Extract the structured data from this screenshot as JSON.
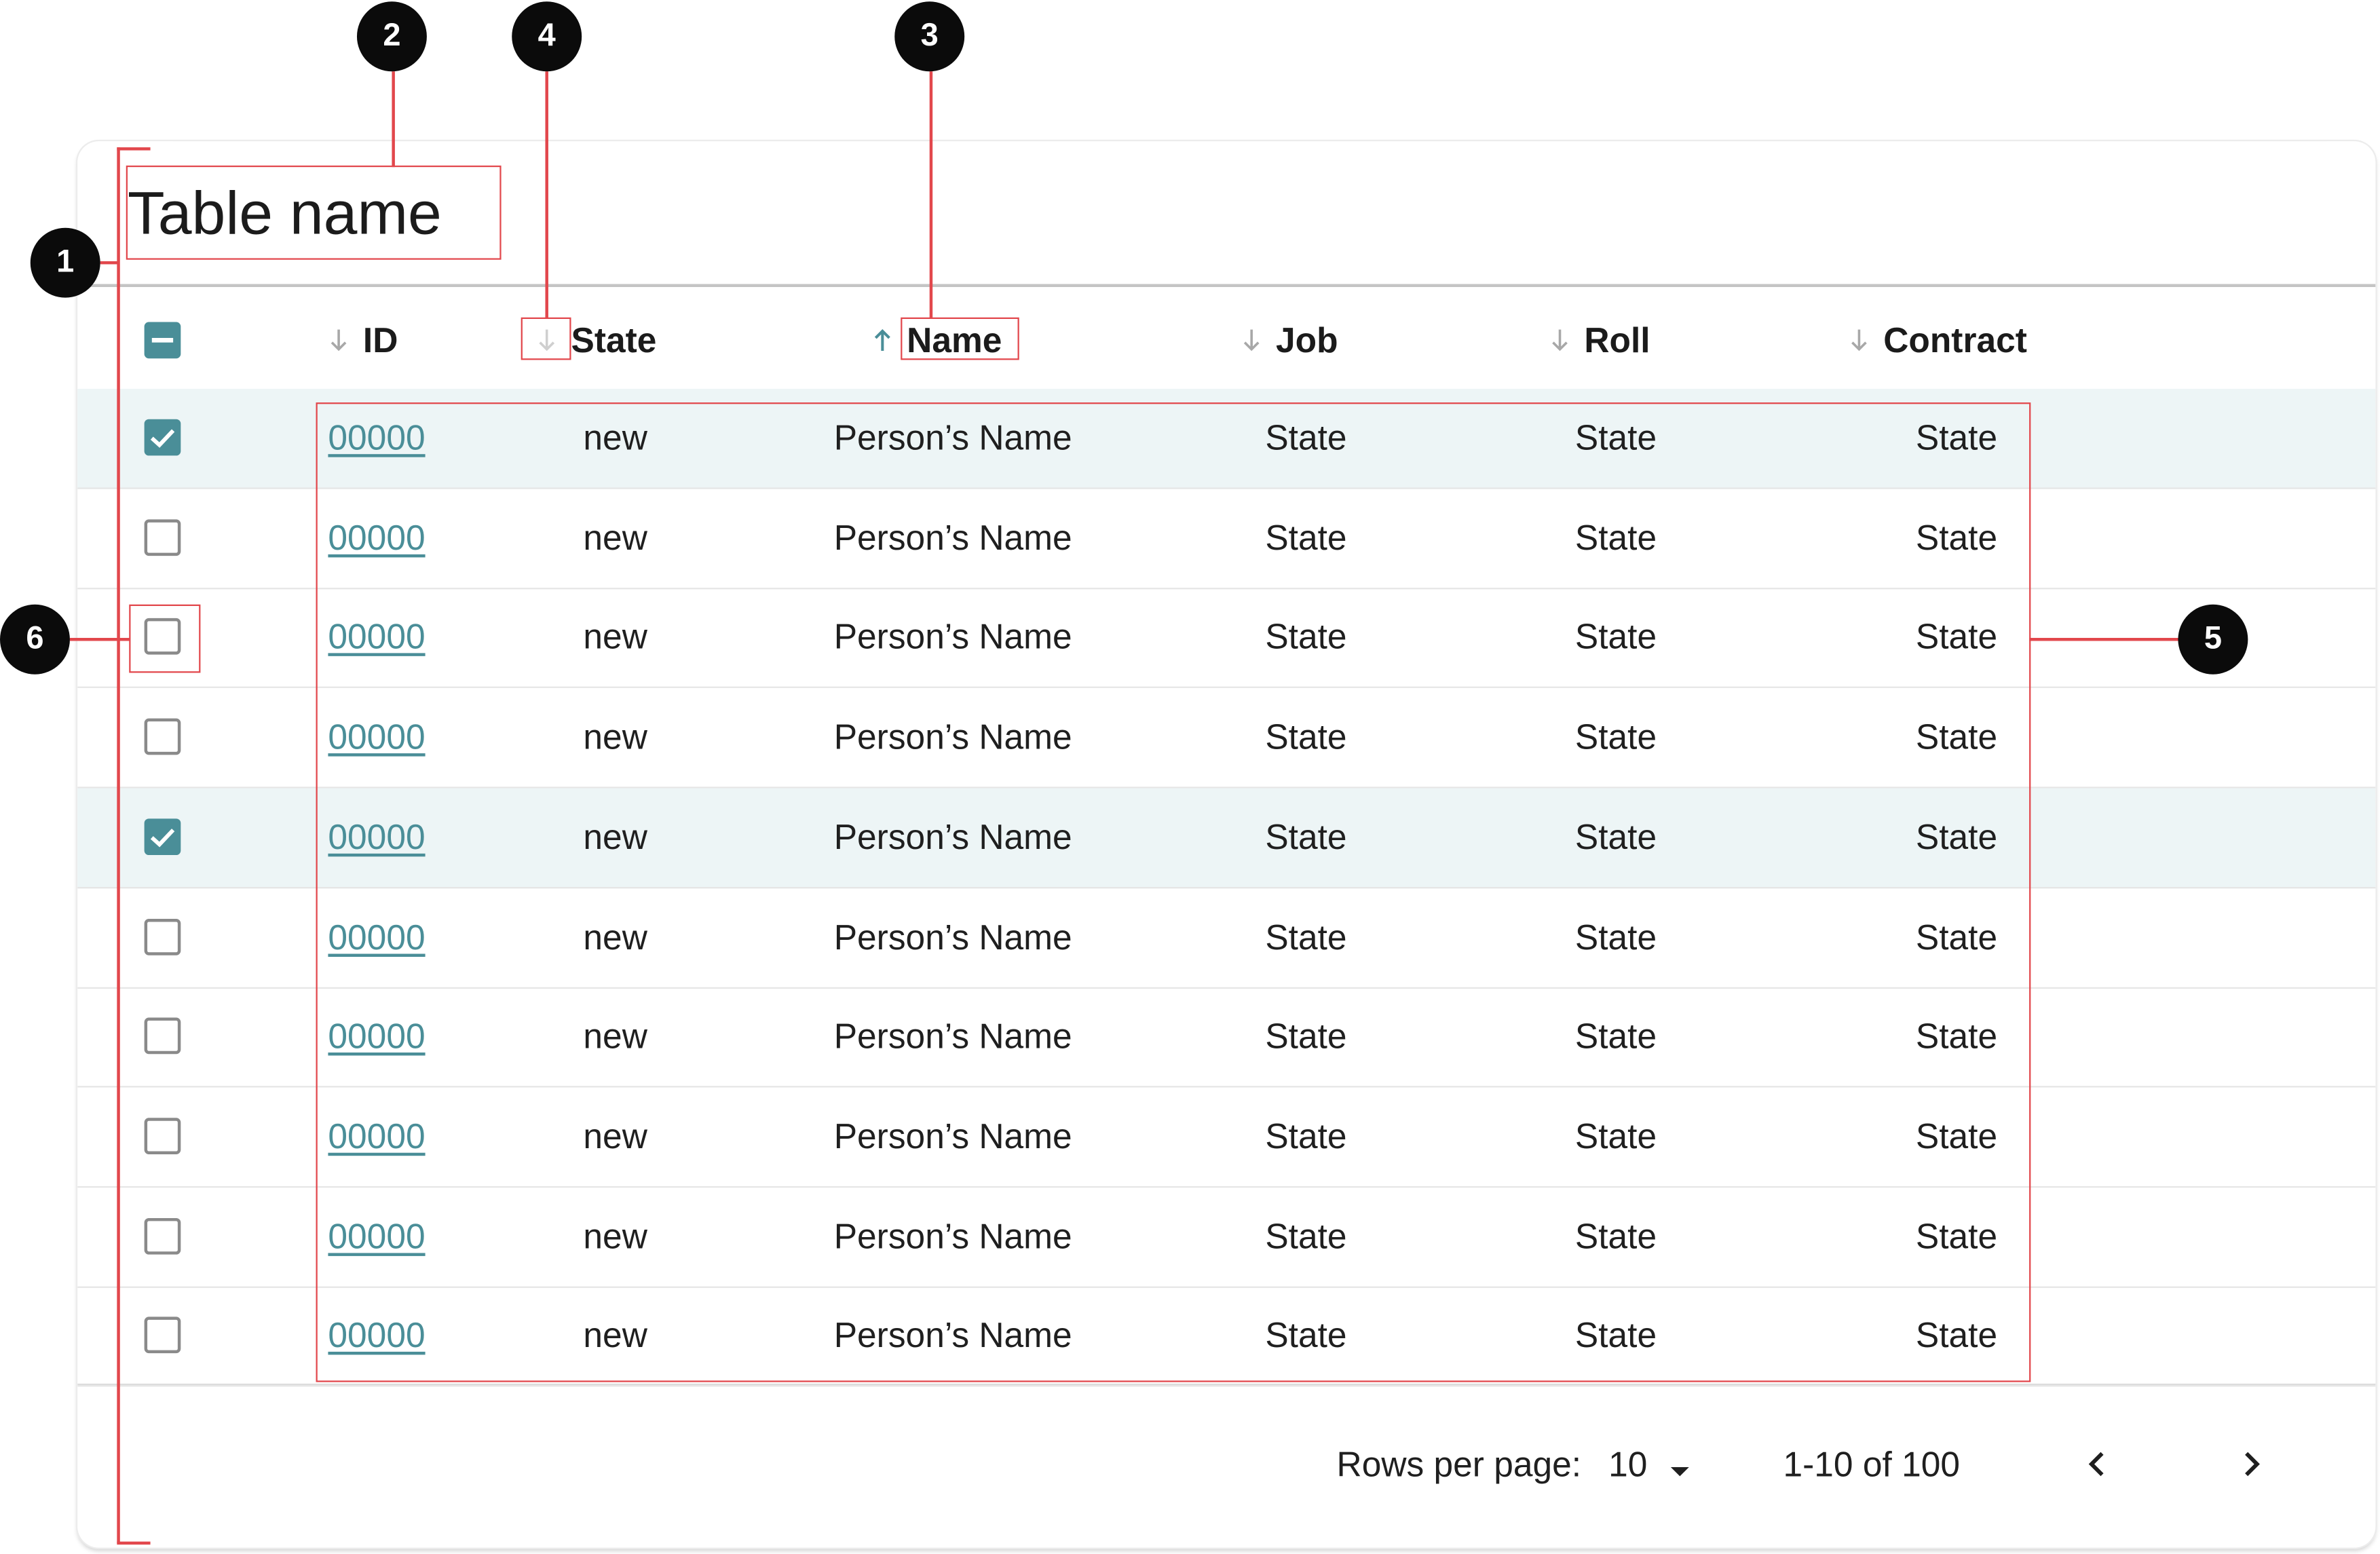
{
  "table": {
    "title": "Table name",
    "columns": [
      {
        "label": "ID",
        "sort": "down"
      },
      {
        "label": "State",
        "sort": "down"
      },
      {
        "label": "Name",
        "sort": "up"
      },
      {
        "label": "Job",
        "sort": "down"
      },
      {
        "label": "Roll",
        "sort": "down"
      },
      {
        "label": "Contract",
        "sort": "down"
      }
    ],
    "select_all": "indeterminate",
    "rows": [
      {
        "selected": true,
        "id": "00000",
        "state": "new",
        "name": "Person’s Name",
        "job": "State",
        "roll": "State",
        "contract": "State"
      },
      {
        "selected": false,
        "id": "00000",
        "state": "new",
        "name": "Person’s Name",
        "job": "State",
        "roll": "State",
        "contract": "State"
      },
      {
        "selected": false,
        "id": "00000",
        "state": "new",
        "name": "Person’s Name",
        "job": "State",
        "roll": "State",
        "contract": "State"
      },
      {
        "selected": false,
        "id": "00000",
        "state": "new",
        "name": "Person’s Name",
        "job": "State",
        "roll": "State",
        "contract": "State"
      },
      {
        "selected": true,
        "id": "00000",
        "state": "new",
        "name": "Person’s Name",
        "job": "State",
        "roll": "State",
        "contract": "State"
      },
      {
        "selected": false,
        "id": "00000",
        "state": "new",
        "name": "Person’s Name",
        "job": "State",
        "roll": "State",
        "contract": "State"
      },
      {
        "selected": false,
        "id": "00000",
        "state": "new",
        "name": "Person’s Name",
        "job": "State",
        "roll": "State",
        "contract": "State"
      },
      {
        "selected": false,
        "id": "00000",
        "state": "new",
        "name": "Person’s Name",
        "job": "State",
        "roll": "State",
        "contract": "State"
      },
      {
        "selected": false,
        "id": "00000",
        "state": "new",
        "name": "Person’s Name",
        "job": "State",
        "roll": "State",
        "contract": "State"
      },
      {
        "selected": false,
        "id": "00000",
        "state": "new",
        "name": "Person’s Name",
        "job": "State",
        "roll": "State",
        "contract": "State"
      }
    ]
  },
  "pagination": {
    "rows_per_page_label": "Rows per page:",
    "rows_per_page_value": "10",
    "range_text": "1-10 of 100",
    "prev_icon": "chevron-left-icon",
    "next_icon": "chevron-right-icon"
  },
  "callouts": [
    "1",
    "2",
    "3",
    "4",
    "5",
    "6"
  ],
  "colors": {
    "accent": "#4a8e98",
    "selected_row_bg": "#edf5f6",
    "annotation": "#e2474c",
    "callout_bg": "#0b0b0b"
  }
}
